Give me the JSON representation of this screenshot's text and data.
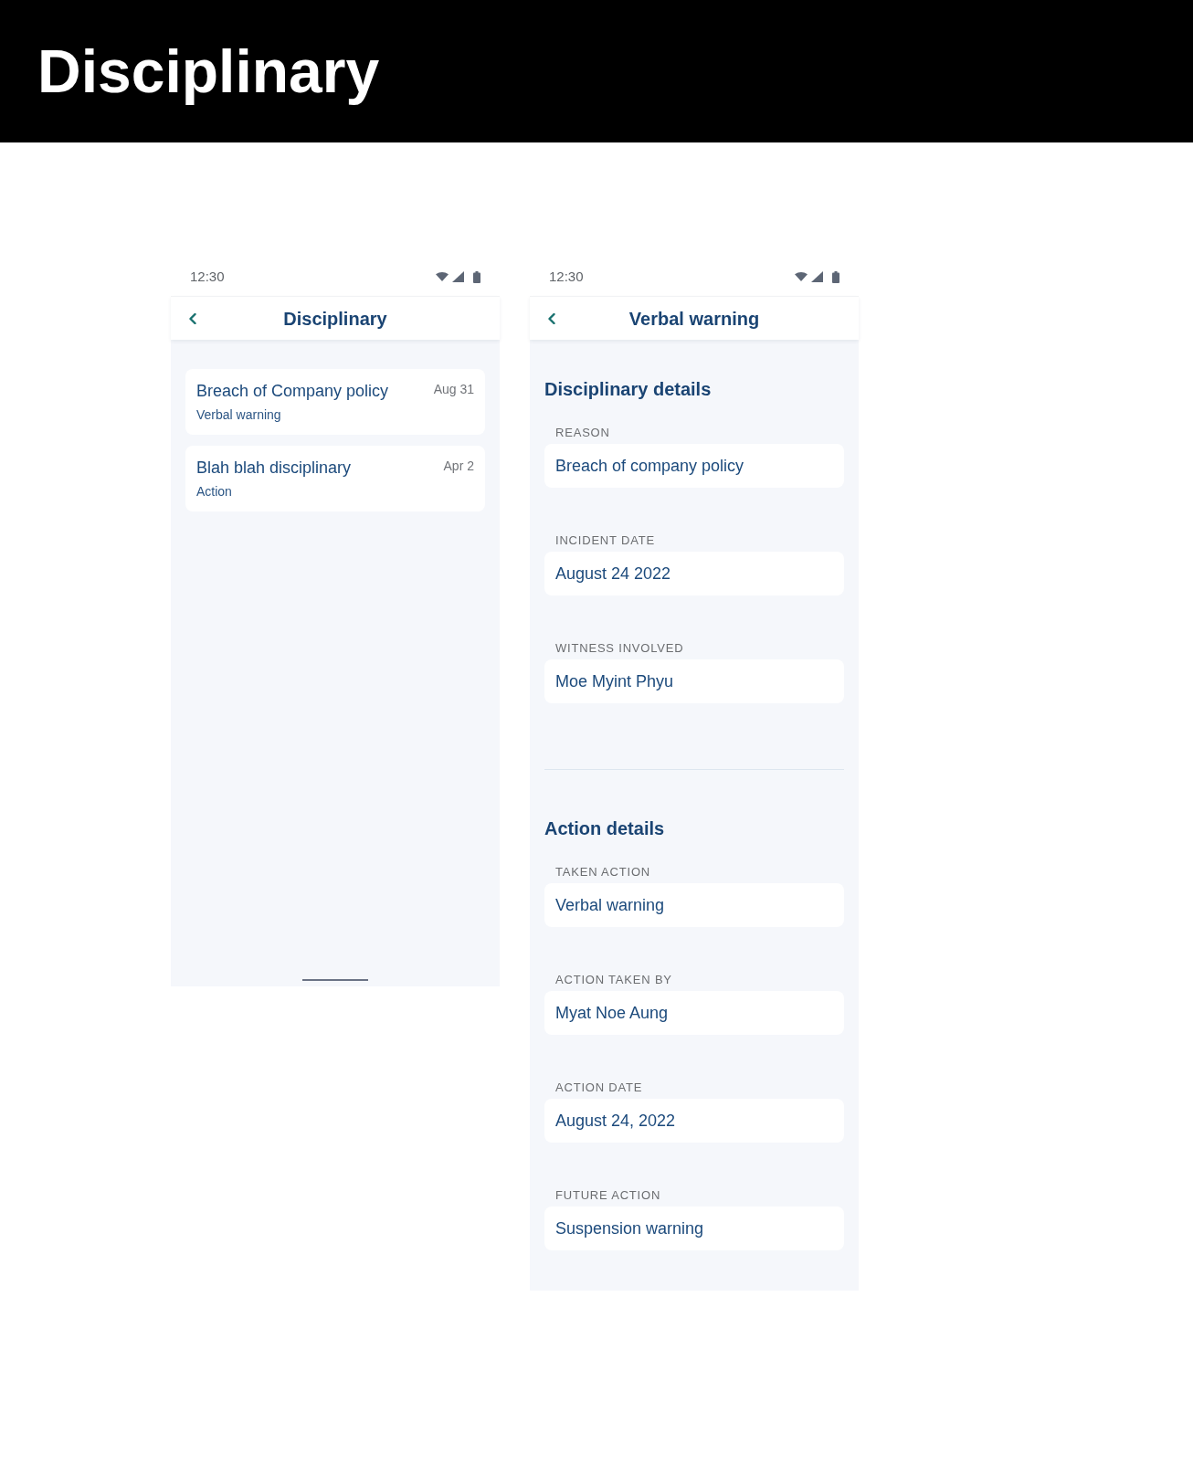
{
  "header": {
    "title": "Disciplinary"
  },
  "screens": [
    {
      "kind": "list",
      "status_bar": {
        "time": "12:30"
      },
      "app_bar": {
        "title": "Disciplinary"
      },
      "items": [
        {
          "title": "Breach of Company policy",
          "subtitle": "Verbal warning",
          "date": "Aug 31"
        },
        {
          "title": "Blah blah disciplinary",
          "subtitle": "Action",
          "date": "Apr 2"
        }
      ]
    },
    {
      "kind": "detail",
      "status_bar": {
        "time": "12:30"
      },
      "app_bar": {
        "title": "Verbal warning"
      },
      "sections": [
        {
          "title": "Disciplinary details",
          "fields": [
            {
              "label": "REASON",
              "value": "Breach of company policy"
            },
            {
              "label": "INCIDENT DATE",
              "value": "August 24 2022"
            },
            {
              "label": "WITNESS INVOLVED",
              "value": "Moe Myint Phyu"
            }
          ]
        },
        {
          "title": "Action details",
          "fields": [
            {
              "label": "TAKEN ACTION",
              "value": "Verbal warning"
            },
            {
              "label": "ACTION TAKEN BY",
              "value": "Myat Noe Aung"
            },
            {
              "label": "ACTION DATE",
              "value": "August 24, 2022"
            },
            {
              "label": "FUTURE ACTION",
              "value": "Suspension warning"
            }
          ]
        }
      ]
    }
  ]
}
